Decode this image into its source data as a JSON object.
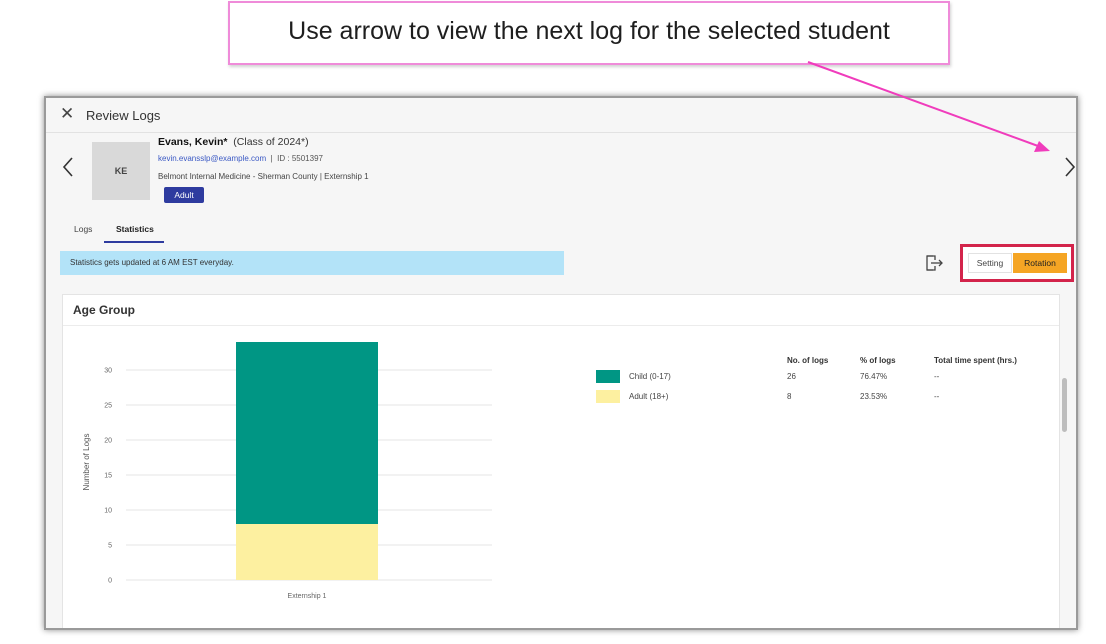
{
  "callout": {
    "text": "Use arrow to view the next log for the selected student"
  },
  "window": {
    "title": "Review Logs"
  },
  "student": {
    "initials": "KE",
    "name": "Evans, Kevin*",
    "class": "(Class of 2024*)",
    "email": "kevin.evansslp@example.com",
    "separator": "|",
    "id": "ID : 5501397",
    "site": "Belmont Internal Medicine - Sherman County | Externship 1",
    "badge": "Adult"
  },
  "tabs": [
    {
      "label": "Logs",
      "active": false
    },
    {
      "label": "Statistics",
      "active": true
    }
  ],
  "info_banner": "Statistics gets updated at 6 AM EST everyday.",
  "toggle": {
    "options": [
      "Setting",
      "Rotation"
    ],
    "selected": "Rotation"
  },
  "panel": {
    "title": "Age Group"
  },
  "legend": {
    "headers": [
      "No. of logs",
      "% of logs",
      "Total time spent (hrs.)"
    ],
    "rows": [
      {
        "label": "Child (0-17)",
        "count": "26",
        "percent": "76.47%",
        "time": "--",
        "color": "#009684"
      },
      {
        "label": "Adult (18+)",
        "count": "8",
        "percent": "23.53%",
        "time": "--",
        "color": "#fdf0a0"
      }
    ]
  },
  "colors": {
    "accent": "#2e3b9f",
    "child": "#009684",
    "adult": "#fdf0a0",
    "rotation": "#f5a524",
    "highlight_border": "#d3244b",
    "callout_arrow": "#f03cbc"
  },
  "icons": [
    "close-icon",
    "chevron-left-icon",
    "chevron-right-icon",
    "export-icon"
  ],
  "chart_data": {
    "type": "bar",
    "stacked": true,
    "categories": [
      "Externship 1"
    ],
    "series": [
      {
        "name": "Adult (18+)",
        "values": [
          8
        ],
        "color": "#fdf0a0"
      },
      {
        "name": "Child (0-17)",
        "values": [
          26
        ],
        "color": "#009684"
      }
    ],
    "ylabel": "Number of Logs",
    "xlabel": "",
    "yticks": [
      0,
      5,
      10,
      15,
      20,
      25,
      30
    ],
    "ylim": [
      0,
      34
    ],
    "grid": true
  }
}
